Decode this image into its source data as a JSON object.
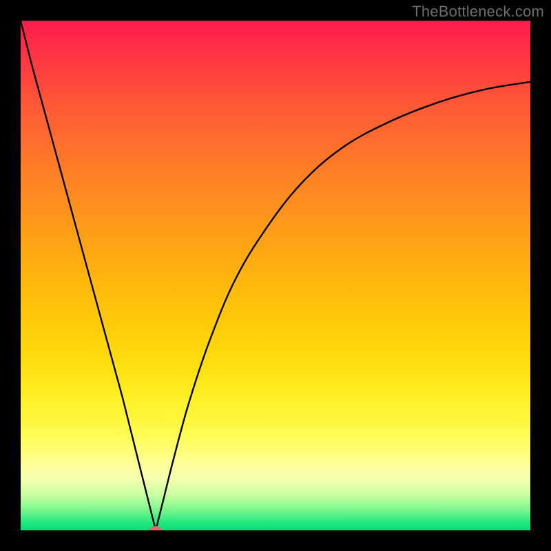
{
  "watermark": "TheBottleneck.com",
  "chart_data": {
    "type": "line",
    "title": "",
    "xlabel": "",
    "ylabel": "",
    "x_range": [
      0,
      100
    ],
    "y_range": [
      0,
      100
    ],
    "grid": false,
    "legend": false,
    "background": "rainbow-gradient",
    "gradient_stops": [
      {
        "pos": 0,
        "color": "#ff1a4d"
      },
      {
        "pos": 0.5,
        "color": "#ffcc08"
      },
      {
        "pos": 0.85,
        "color": "#ffff99"
      },
      {
        "pos": 1.0,
        "color": "#06de78"
      }
    ],
    "series": [
      {
        "name": "bottleneck-curve",
        "type": "line",
        "color": "#000000",
        "x": [
          0,
          2,
          5,
          8,
          11,
          14,
          17,
          20,
          23,
          25,
          26,
          26.5,
          27,
          28,
          30,
          33,
          37,
          42,
          48,
          55,
          63,
          72,
          82,
          91,
          100
        ],
        "values": [
          100,
          92,
          81,
          70,
          59,
          48,
          37,
          26,
          14,
          6,
          2,
          0,
          2,
          6,
          14,
          25,
          37,
          49,
          59,
          68,
          75,
          80,
          84,
          86.5,
          88
        ]
      }
    ],
    "marker": {
      "name": "optimum-point",
      "x": 26.5,
      "y": 0,
      "color": "#de6a72",
      "shape": "ellipse"
    }
  }
}
